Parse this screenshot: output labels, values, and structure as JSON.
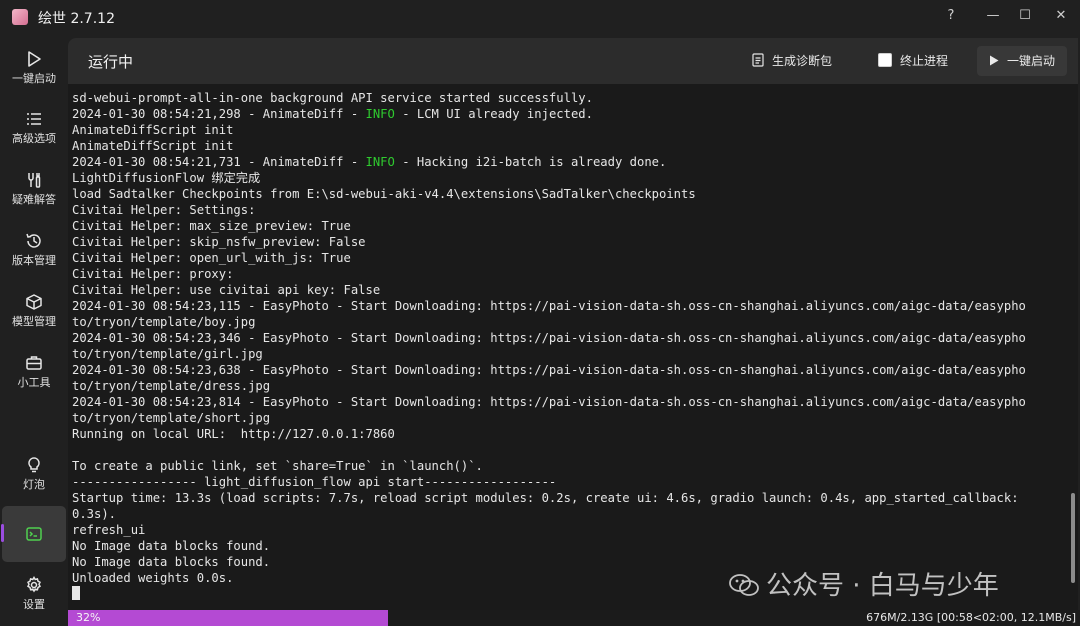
{
  "window": {
    "title": "绘世 2.7.12",
    "controls": [
      "?",
      "—",
      "☐",
      "✕"
    ]
  },
  "sidebar": {
    "items": [
      {
        "label": "一键启动",
        "icon": "play-icon"
      },
      {
        "label": "高级选项",
        "icon": "list-icon"
      },
      {
        "label": "疑难解答",
        "icon": "tools-icon"
      },
      {
        "label": "版本管理",
        "icon": "history-icon"
      },
      {
        "label": "模型管理",
        "icon": "cube-icon"
      },
      {
        "label": "小工具",
        "icon": "toolbox-icon"
      },
      {
        "label": "灯泡",
        "icon": "lightbulb-icon"
      },
      {
        "label": "",
        "icon": "console-icon",
        "active": true
      },
      {
        "label": "设置",
        "icon": "gear-icon"
      }
    ]
  },
  "header": {
    "title": "运行中",
    "diagnostics_label": "生成诊断包",
    "terminate_label": "终止进程",
    "launch_label": "一键启动"
  },
  "console": {
    "lines": [
      [
        {
          "t": "sd-webui-prompt-all-in-one background API service started successfully."
        }
      ],
      [
        {
          "t": "2024-01-30 08:54:21,298 - AnimateDiff - "
        },
        {
          "t": "INFO",
          "c": "info"
        },
        {
          "t": " - LCM UI already injected."
        }
      ],
      [
        {
          "t": "AnimateDiffScript init"
        }
      ],
      [
        {
          "t": "AnimateDiffScript init"
        }
      ],
      [
        {
          "t": "2024-01-30 08:54:21,731 - AnimateDiff - "
        },
        {
          "t": "INFO",
          "c": "info"
        },
        {
          "t": " - Hacking i2i-batch is already done."
        }
      ],
      [
        {
          "t": "LightDiffusionFlow 绑定完成"
        }
      ],
      [
        {
          "t": "load Sadtalker Checkpoints from E:\\sd-webui-aki-v4.4\\extensions\\SadTalker\\checkpoints"
        }
      ],
      [
        {
          "t": "Civitai Helper: Settings:"
        }
      ],
      [
        {
          "t": "Civitai Helper: max_size_preview: True"
        }
      ],
      [
        {
          "t": "Civitai Helper: skip_nsfw_preview: False"
        }
      ],
      [
        {
          "t": "Civitai Helper: open_url_with_js: True"
        }
      ],
      [
        {
          "t": "Civitai Helper: proxy:"
        }
      ],
      [
        {
          "t": "Civitai Helper: use civitai api key: False"
        }
      ],
      [
        {
          "t": "2024-01-30 08:54:23,115 - EasyPhoto - Start Downloading: https://pai-vision-data-sh.oss-cn-shanghai.aliyuncs.com/aigc-data/easypho"
        }
      ],
      [
        {
          "t": "to/tryon/template/boy.jpg"
        }
      ],
      [
        {
          "t": "2024-01-30 08:54:23,346 - EasyPhoto - Start Downloading: https://pai-vision-data-sh.oss-cn-shanghai.aliyuncs.com/aigc-data/easypho"
        }
      ],
      [
        {
          "t": "to/tryon/template/girl.jpg"
        }
      ],
      [
        {
          "t": "2024-01-30 08:54:23,638 - EasyPhoto - Start Downloading: https://pai-vision-data-sh.oss-cn-shanghai.aliyuncs.com/aigc-data/easypho"
        }
      ],
      [
        {
          "t": "to/tryon/template/dress.jpg"
        }
      ],
      [
        {
          "t": "2024-01-30 08:54:23,814 - EasyPhoto - Start Downloading: https://pai-vision-data-sh.oss-cn-shanghai.aliyuncs.com/aigc-data/easypho"
        }
      ],
      [
        {
          "t": "to/tryon/template/short.jpg"
        }
      ],
      [
        {
          "t": "Running on local URL:  http://127.0.0.1:7860"
        }
      ],
      [
        {
          "t": ""
        }
      ],
      [
        {
          "t": "To create a public link, set `share=True` in `launch()`."
        }
      ],
      [
        {
          "t": "----------------- light_diffusion_flow api start------------------"
        }
      ],
      [
        {
          "t": "Startup time: 13.3s (load scripts: 7.7s, reload script modules: 0.2s, create ui: 4.6s, gradio launch: 0.4s, app_started_callback:"
        }
      ],
      [
        {
          "t": "0.3s)."
        }
      ],
      [
        {
          "t": "refresh_ui"
        }
      ],
      [
        {
          "t": "No Image data blocks found."
        }
      ],
      [
        {
          "t": "No Image data blocks found."
        }
      ],
      [
        {
          "t": "Unloaded weights 0.0s."
        }
      ]
    ]
  },
  "status": {
    "progress_label": "32%",
    "progress_fraction": 0.32,
    "transfer": "676M/2.13G [00:58<02:00, 12.1MB/s]"
  },
  "watermark": {
    "text": "公众号 · 白马与少年"
  },
  "colors": {
    "accent": "#b44ad3",
    "info": "#2fcb2f"
  }
}
